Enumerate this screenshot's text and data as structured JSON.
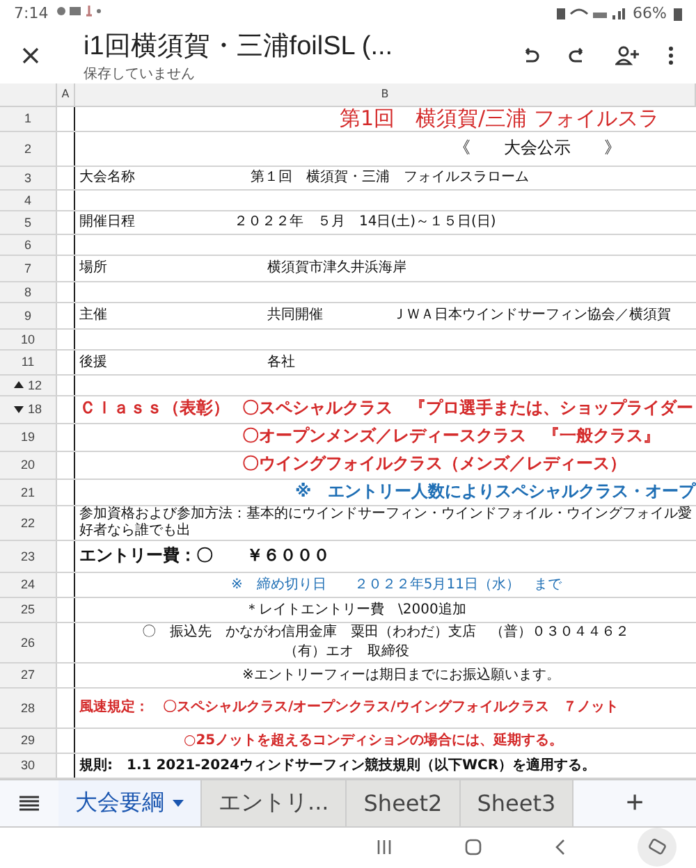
{
  "status_bar": {
    "time": "7:14",
    "battery": "66%"
  },
  "toolbar": {
    "title": "i1回横須賀・三浦foilSL (...",
    "subtitle": "保存していません"
  },
  "column_headers": [
    "A",
    "B"
  ],
  "rows": [
    {
      "number": "1",
      "segments": [
        {
          "text": "第1回　横須賀/三浦 フォイルスラ",
          "color": "#d42a2a",
          "bold": false
        }
      ]
    },
    {
      "number": "2",
      "segments": [
        {
          "text": "《　　大会公示　　》",
          "color": "#111111",
          "bold": false
        }
      ]
    },
    {
      "number": "3",
      "segments": [
        {
          "text": "大会名称",
          "color": "#111111",
          "bold": false
        },
        {
          "text": "第１回　横須賀・三浦　フォイルスラローム",
          "color": "#111111",
          "bold": false
        }
      ]
    },
    {
      "number": "4",
      "segments": []
    },
    {
      "number": "5",
      "segments": [
        {
          "text": "開催日程",
          "color": "#111111",
          "bold": false
        },
        {
          "text": "２０２２年　５月　14日(土)～１５日(日)",
          "color": "#111111",
          "bold": false
        }
      ]
    },
    {
      "number": "6",
      "segments": []
    },
    {
      "number": "7",
      "segments": [
        {
          "text": "場所",
          "color": "#111111",
          "bold": false
        },
        {
          "text": "横須賀市津久井浜海岸",
          "color": "#111111",
          "bold": false
        }
      ]
    },
    {
      "number": "8",
      "segments": []
    },
    {
      "number": "9",
      "segments": [
        {
          "text": "主催",
          "color": "#111111",
          "bold": false
        },
        {
          "text": "共同開催",
          "color": "#111111",
          "bold": false
        },
        {
          "text": "ＪＷＡ日本ウインドサーフィン協会／横須賀",
          "color": "#111111",
          "bold": false
        }
      ]
    },
    {
      "number": "10",
      "segments": []
    },
    {
      "number": "11",
      "segments": [
        {
          "text": "後援",
          "color": "#111111",
          "bold": false
        },
        {
          "text": "各社",
          "color": "#111111",
          "bold": false
        }
      ]
    },
    {
      "number": "12",
      "kind": "collapse",
      "segments": []
    },
    {
      "number": "18",
      "kind": "expand",
      "segments": [
        {
          "text": "Ｃｌａｓｓ（表彰）",
          "color": "#d42a2a",
          "bold": true
        },
        {
          "text": "〇スペシャルクラス　『プロ選手または、ショップライダー",
          "color": "#d42a2a",
          "bold": true
        }
      ]
    },
    {
      "number": "19",
      "segments": [
        {
          "text": "〇オープンメンズ／レディースクラス　『一般クラス』",
          "color": "#d42a2a",
          "bold": true
        }
      ]
    },
    {
      "number": "20",
      "segments": [
        {
          "text": "〇ウイングフォイルクラス（メンズ／レディース）",
          "color": "#d42a2a",
          "bold": true
        }
      ]
    },
    {
      "number": "21",
      "segments": [
        {
          "text": "※　エントリー人数によりスペシャルクラス・オープ",
          "color": "#1f6fb5",
          "bold": true
        }
      ]
    },
    {
      "number": "22",
      "segments": [
        {
          "text": "参加資格および参加方法：基本的にウインドサーフィン・ウインドフォイル・ウイングフォイル愛好者なら誰でも出",
          "color": "#111111",
          "bold": false
        }
      ]
    },
    {
      "number": "23",
      "segments": [
        {
          "text": "エントリー費：〇　　￥６０００",
          "color": "#111111",
          "bold": true
        }
      ]
    },
    {
      "number": "24",
      "segments": [
        {
          "text": "※　締め切り日　　２０２２年5月11日（水）　まで",
          "color": "#1f6fb5",
          "bold": false
        }
      ]
    },
    {
      "number": "25",
      "segments": [
        {
          "text": "＊レイトエントリー費　\\2000追加",
          "color": "#111111",
          "bold": false
        }
      ]
    },
    {
      "number": "26",
      "segments": [
        {
          "text": "〇　振込先　かながわ信用金庫　粟田（わわだ）支店　（普）０３０４４６２",
          "color": "#111111",
          "bold": false
        },
        {
          "text": "（有）エオ　取締役",
          "color": "#111111",
          "bold": false
        }
      ]
    },
    {
      "number": "27",
      "segments": [
        {
          "text": "※エントリーフィーは期日までにお振込願います。",
          "color": "#111111",
          "bold": false
        }
      ]
    },
    {
      "number": "28",
      "segments": [
        {
          "text": "風速規定：　〇スペシャルクラス/オープンクラス/ウイングフォイルクラス　７ノット",
          "color": "#d42a2a",
          "bold": true
        }
      ]
    },
    {
      "number": "29",
      "segments": [
        {
          "text": "○25ノットを超えるコンディションの場合には、延期する。",
          "color": "#d42a2a",
          "bold": true
        }
      ]
    },
    {
      "number": "30",
      "segments": [
        {
          "text": "規則:　1.1 2021-2024ウィンドサーフィン競技規則（以下WCR）を適用する。",
          "color": "#111111",
          "bold": true
        }
      ]
    }
  ],
  "sheet_tabs": [
    {
      "label": "大会要綱",
      "selected": true
    },
    {
      "label": "エントリ...",
      "selected": false
    },
    {
      "label": "Sheet2",
      "selected": false
    },
    {
      "label": "Sheet3",
      "selected": false
    }
  ],
  "add_sheet": "+"
}
